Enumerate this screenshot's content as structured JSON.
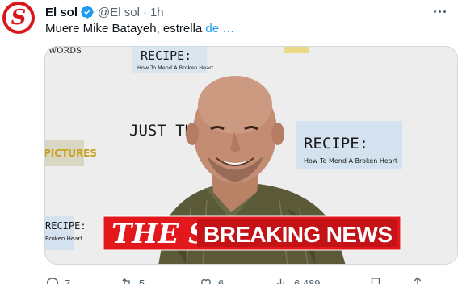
{
  "account": {
    "display_name": "El sol",
    "handle": "@El sol",
    "separator": "·",
    "time": "1h",
    "avatar_icon": "sun-logo-icon",
    "verified_icon": "verified-badge-icon",
    "brand_color": "#d6181d",
    "verified_color": "#1d9bf0"
  },
  "tweet": {
    "text": "Muere Mike Batayeh, estrella ",
    "link_text": "de …"
  },
  "media": {
    "banner_logo": "THE Sun",
    "banner_text": "BREAKING NEWS",
    "backdrop_signs": [
      "RECIPE:",
      "How To Mend A Broken Heart",
      "JUST THREE",
      "RECIPE:",
      "How To Mend A Broken Heart",
      "PICTURES",
      "RECIPE:",
      "Broken Heart"
    ]
  },
  "actions": {
    "reply_count": "7",
    "retweet_count": "5",
    "like_count": "6",
    "views_count": "6.489"
  }
}
